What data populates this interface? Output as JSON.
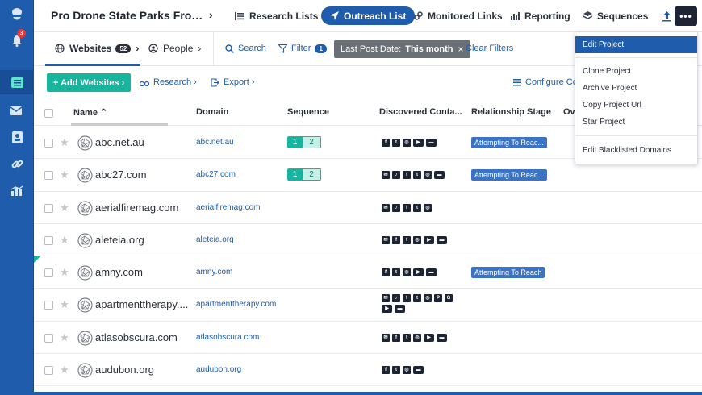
{
  "header": {
    "project_title": "Pro Drone State Parks From ...",
    "tabs": [
      {
        "label": "Research Lists",
        "icon": "research-icon"
      },
      {
        "label": "Outreach List",
        "icon": "send-icon",
        "active": true
      },
      {
        "label": "Monitored Links",
        "icon": "link-icon"
      },
      {
        "label": "Reporting",
        "icon": "bar-chart-icon"
      },
      {
        "label": "Sequences",
        "icon": "layers-icon"
      }
    ],
    "more_label": "•••"
  },
  "subbar": {
    "websites_label": "Websites",
    "websites_count": "52",
    "people_label": "People",
    "search_label": "Search",
    "filter_label": "Filter",
    "filter_count": "1",
    "chip_label": "Last Post Date:",
    "chip_value": "This month",
    "chip_close": "×",
    "clear_filters": "Clear Filters"
  },
  "actions": {
    "add_websites": "+ Add Websites ›",
    "research": "Research ›",
    "export": "Export ›",
    "configure_columns": "Configure Colu"
  },
  "table": {
    "columns": [
      "Name ⌃",
      "Domain",
      "Sequence",
      "Discovered Conta...",
      "Relationship Stage",
      "Ove"
    ],
    "rows": [
      {
        "name": "abc.net.au",
        "domain": "abc.net.au",
        "seq": [
          "1",
          "2"
        ],
        "contacts": [
          "f",
          "t",
          "ig",
          "yt",
          "web"
        ],
        "stage": "Attempting To Reac..."
      },
      {
        "name": "abc27.com",
        "domain": "abc27.com",
        "seq": [
          "1",
          "2"
        ],
        "contacts": [
          "mail",
          "tk",
          "f",
          "t",
          "ig",
          "web"
        ],
        "stage": "Attempting To Reac..."
      },
      {
        "name": "aerialfiremag.com",
        "domain": "aerialfiremag.com",
        "seq": null,
        "contacts": [
          "mail",
          "tk",
          "f",
          "t",
          "ig"
        ],
        "stage": ""
      },
      {
        "name": "aleteia.org",
        "domain": "aleteia.org",
        "seq": null,
        "contacts": [
          "mail",
          "f",
          "t",
          "ig",
          "yt",
          "web"
        ],
        "stage": ""
      },
      {
        "name": "amny.com",
        "domain": "amny.com",
        "seq": null,
        "contacts": [
          "f",
          "t",
          "ig",
          "yt",
          "web"
        ],
        "stage": "Attempting To Reach"
      },
      {
        "name": "apartmenttherapy....",
        "domain": "apartmenttherapy.com",
        "seq": null,
        "contacts": [
          "mail",
          "tk",
          "f",
          "t",
          "ig",
          "p",
          "g",
          "yt",
          "web"
        ],
        "stage": ""
      },
      {
        "name": "atlasobscura.com",
        "domain": "atlasobscura.com",
        "seq": null,
        "contacts": [
          "mail",
          "f",
          "t",
          "ig",
          "yt",
          "web"
        ],
        "stage": ""
      },
      {
        "name": "audubon.org",
        "domain": "audubon.org",
        "seq": null,
        "contacts": [
          "f",
          "t",
          "ig",
          "web"
        ],
        "stage": ""
      }
    ]
  },
  "menu": {
    "items": [
      {
        "label": "Edit Project",
        "active": true
      },
      {
        "label": "Clone Project"
      },
      {
        "label": "Archive Project"
      },
      {
        "label": "Copy Project Url"
      },
      {
        "label": "Star Project"
      },
      {
        "label": "Edit Blacklisted Domains"
      }
    ]
  },
  "rail": {
    "notification_count": "3"
  },
  "colors": {
    "brand": "#1f5cab",
    "accent": "#18b59e",
    "stage": "#3b74c4"
  }
}
